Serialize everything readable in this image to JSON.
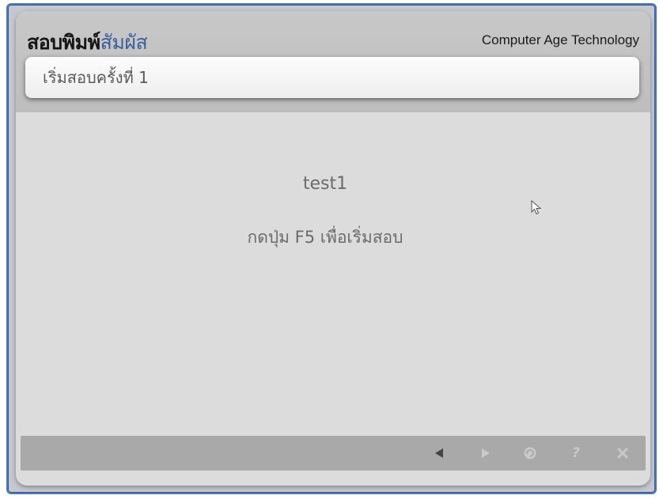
{
  "header": {
    "app_title_main": "สอบพิมพ์",
    "app_title_accent": "สัมผัส",
    "company": "Computer Age Technology",
    "subtitle": "เริ่มสอบครั้งที่ 1"
  },
  "main": {
    "test_name": "test1",
    "instruction": "กดปุ่ม F5 เพื่อเริ่มสอบ"
  },
  "toolbar": {
    "buttons": [
      {
        "icon": "back-arrow-icon",
        "enabled": true
      },
      {
        "icon": "forward-arrow-icon",
        "enabled": false
      },
      {
        "icon": "refresh-icon",
        "enabled": false
      },
      {
        "icon": "help-icon",
        "glyph": "?",
        "enabled": false
      },
      {
        "icon": "close-icon",
        "enabled": false
      }
    ]
  },
  "colors": {
    "frame_border": "#4c79b8",
    "title_accent": "#3b5f9c",
    "toolbar_bg": "#a9a9a9",
    "icon_active": "#444444",
    "icon_disabled": "#c9c9c9"
  }
}
